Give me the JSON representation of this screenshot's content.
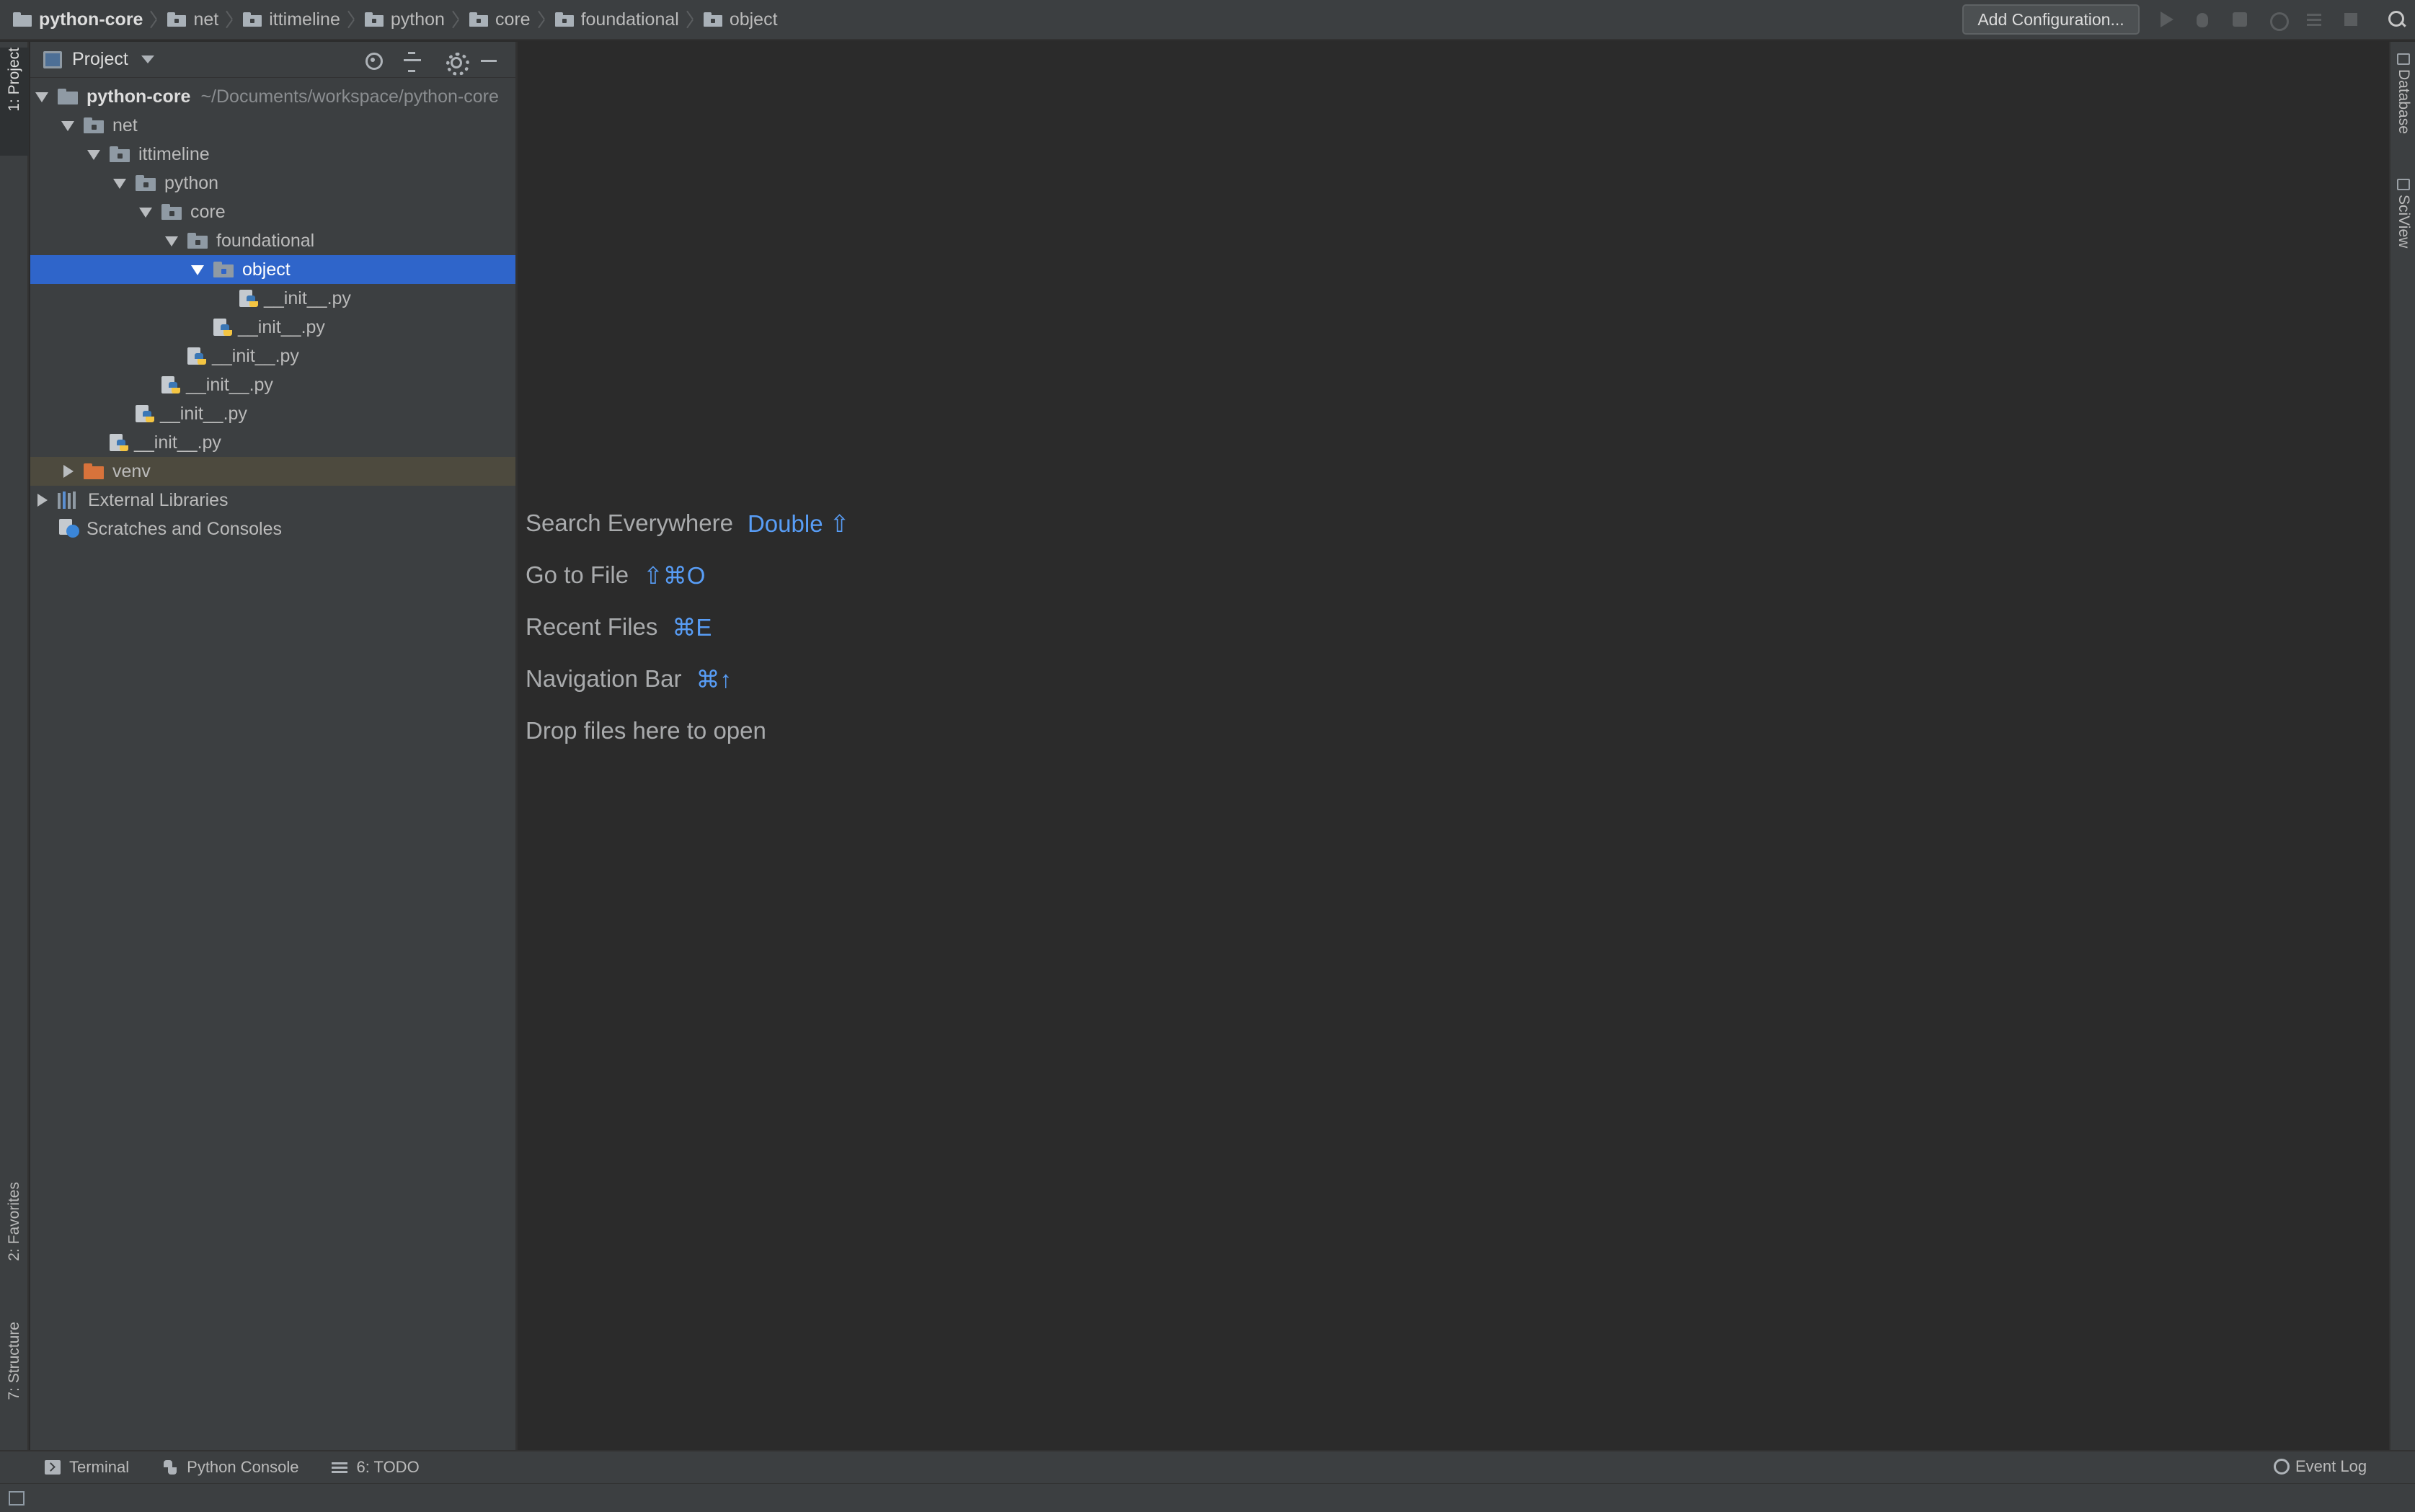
{
  "breadcrumb": [
    {
      "label": "python-core",
      "icon": "folder-icon"
    },
    {
      "label": "net",
      "icon": "package-icon"
    },
    {
      "label": "ittimeline",
      "icon": "package-icon"
    },
    {
      "label": "python",
      "icon": "package-icon"
    },
    {
      "label": "core",
      "icon": "package-icon"
    },
    {
      "label": "foundational",
      "icon": "package-icon"
    },
    {
      "label": "object",
      "icon": "package-icon"
    }
  ],
  "toolbar": {
    "add_configuration_label": "Add Configuration...",
    "icons": [
      "run-icon",
      "debug-icon",
      "coverage-icon",
      "profile-icon",
      "concurrency-icon",
      "stop-icon",
      "search-icon"
    ]
  },
  "left_strip": {
    "project_tab": "1: Project",
    "favorites_tab": "2: Favorites",
    "structure_tab": "7: Structure"
  },
  "right_strip": {
    "database_tab": "Database",
    "sciview_tab": "SciView"
  },
  "project_panel": {
    "title": "Project",
    "tree": [
      {
        "label": "python-core",
        "hint": "~/Documents/workspace/python-core",
        "kind": "folder",
        "expanded": true
      },
      {
        "label": "net",
        "kind": "package",
        "expanded": true
      },
      {
        "label": "ittimeline",
        "kind": "package",
        "expanded": true
      },
      {
        "label": "python",
        "kind": "package",
        "expanded": true
      },
      {
        "label": "core",
        "kind": "package",
        "expanded": true
      },
      {
        "label": "foundational",
        "kind": "package",
        "expanded": true
      },
      {
        "label": "object",
        "kind": "package",
        "expanded": true,
        "selected": true
      },
      {
        "label": "__init__.py",
        "kind": "python-file"
      },
      {
        "label": "__init__.py",
        "kind": "python-file"
      },
      {
        "label": "__init__.py",
        "kind": "python-file"
      },
      {
        "label": "__init__.py",
        "kind": "python-file"
      },
      {
        "label": "__init__.py",
        "kind": "python-file"
      },
      {
        "label": "__init__.py",
        "kind": "python-file"
      },
      {
        "label": "venv",
        "kind": "excluded-folder",
        "expanded": false
      },
      {
        "label": "External Libraries",
        "kind": "libraries",
        "expanded": false
      },
      {
        "label": "Scratches and Consoles",
        "kind": "scratches"
      }
    ]
  },
  "editor": {
    "hints": [
      {
        "label": "Search Everywhere",
        "shortcut": "Double ⇧"
      },
      {
        "label": "Go to File",
        "shortcut": "⇧⌘O"
      },
      {
        "label": "Recent Files",
        "shortcut": "⌘E"
      },
      {
        "label": "Navigation Bar",
        "shortcut": "⌘↑"
      },
      {
        "label": "Drop files here to open",
        "shortcut": ""
      }
    ]
  },
  "bottom_tools": {
    "terminal": "Terminal",
    "python_console": "Python Console",
    "todo": "6: TODO",
    "event_log": "Event Log"
  },
  "colors": {
    "selection": "#2f65ca",
    "shortcut_key": "#589df6",
    "excluded_row": "#4d4a3e",
    "excluded_folder": "#d8733b"
  }
}
